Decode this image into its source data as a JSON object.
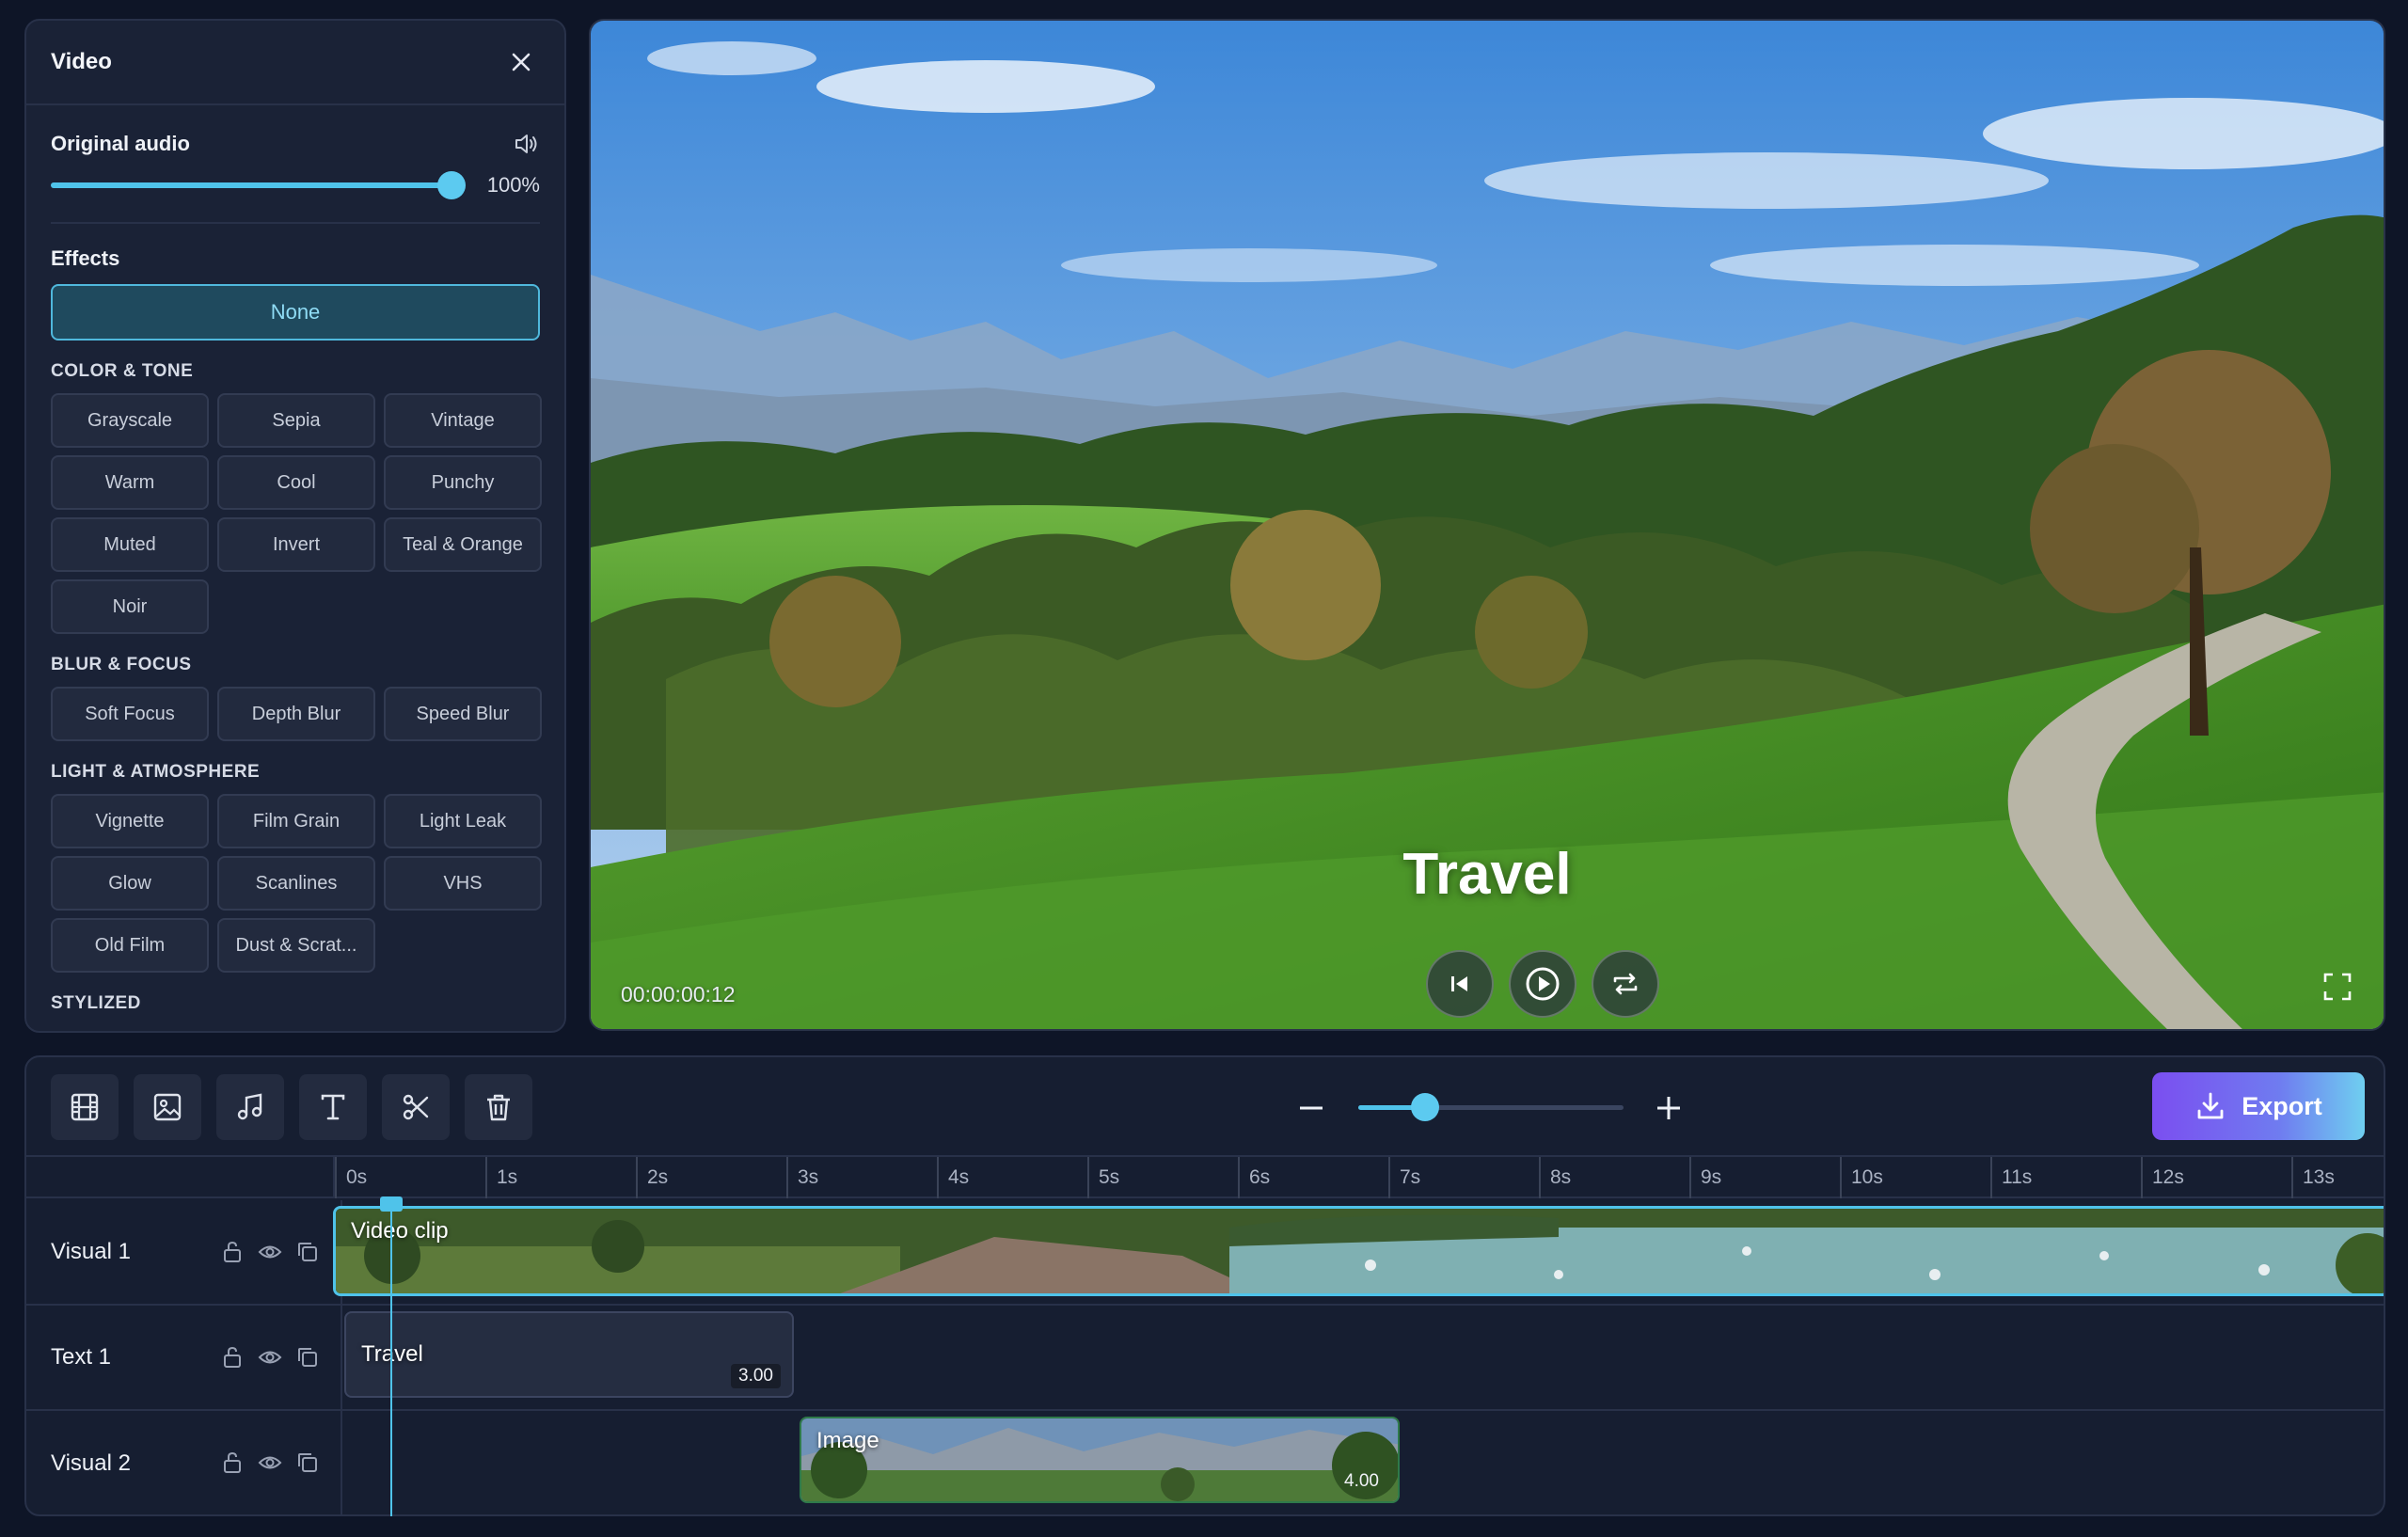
{
  "panel": {
    "title": "Video",
    "audio": {
      "label": "Original audio",
      "value": "100%",
      "level": 1.0
    },
    "effects_label": "Effects",
    "none_label": "None",
    "sections": [
      {
        "title": "COLOR & TONE",
        "items": [
          "Grayscale",
          "Sepia",
          "Vintage",
          "Warm",
          "Cool",
          "Punchy",
          "Muted",
          "Invert",
          "Teal & Orange",
          "Noir"
        ]
      },
      {
        "title": "BLUR & FOCUS",
        "items": [
          "Soft Focus",
          "Depth Blur",
          "Speed Blur"
        ]
      },
      {
        "title": "LIGHT & ATMOSPHERE",
        "items": [
          "Vignette",
          "Film Grain",
          "Light Leak",
          "Glow",
          "Scanlines",
          "VHS",
          "Old Film",
          "Dust & Scrat..."
        ]
      },
      {
        "title": "STYLIZED",
        "items": []
      }
    ]
  },
  "preview": {
    "overlay_text": "Travel",
    "timecode": "00:00:00:12"
  },
  "timeline": {
    "export_label": "Export",
    "zoom_level": 0.25,
    "ruler": [
      "0s",
      "1s",
      "2s",
      "3s",
      "4s",
      "5s",
      "6s",
      "7s",
      "8s",
      "9s",
      "10s",
      "11s",
      "12s",
      "13s"
    ],
    "tracks": {
      "visual1": {
        "name": "Visual 1",
        "clip_label": "Video clip"
      },
      "text1": {
        "name": "Text 1",
        "clip_label": "Travel",
        "duration": "3.00"
      },
      "visual2": {
        "name": "Visual 2",
        "clip_label": "Image",
        "duration": "4.00"
      }
    }
  },
  "colors": {
    "accent": "#4fc3ea",
    "background": "#0e1527",
    "panel": "#1a2236",
    "export_start": "#7b4ef0",
    "export_end": "#6fcff0"
  }
}
